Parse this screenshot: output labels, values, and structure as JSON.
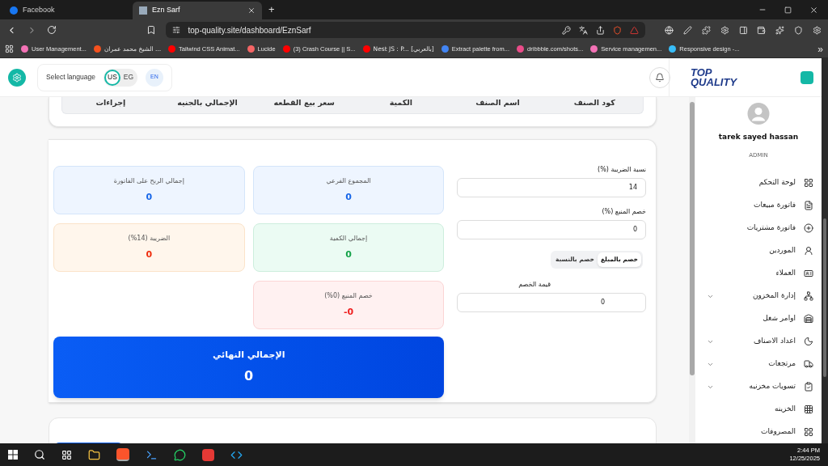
{
  "browser": {
    "tabs": [
      {
        "title": "Ezn Sarf",
        "selected": true
      },
      {
        "title": "Facebook",
        "selected": false
      }
    ],
    "new_tab": "+",
    "url": "top-quality.site/dashboard/EznSarf",
    "bookmarks": [
      {
        "label": "Responsive design -...",
        "color": "#38bdf8"
      },
      {
        "label": "Service managemen...",
        "color": "#f472b6"
      },
      {
        "label": "dribbble.com/shots...",
        "color": "#ea4c89"
      },
      {
        "label": "Extract palette from...",
        "color": "#4285f4"
      },
      {
        "label": "Nest JS : P... [بالعربي]",
        "color": "#ff0000"
      },
      {
        "label": "(3) Crash Course || S...",
        "color": "#ff0000"
      },
      {
        "label": "Lucide",
        "color": "#f56565"
      },
      {
        "label": "Tailwind CSS Animat...",
        "color": "#ff0000"
      },
      {
        "label": "الشيخ محمد عمران ...",
        "color": "#f4511e"
      },
      {
        "label": "User Management...",
        "color": "#f472b6"
      }
    ],
    "more": "»"
  },
  "header": {
    "language_label": "Select language",
    "languages": [
      {
        "label": "EG",
        "selected": false
      },
      {
        "label": "US",
        "selected": true
      }
    ],
    "current": "EN",
    "brand": {
      "line1": "TOP",
      "line2": "QUALITY"
    }
  },
  "items_table": {
    "columns": [
      "كود الصنف",
      "اسم الصنف",
      "الكمية",
      "سعر بيع القطعه",
      "الإجمالي بالجنيه",
      "إجراءات"
    ]
  },
  "summary": {
    "stats": [
      {
        "label": "المجموع الفرعي",
        "value": "0",
        "kind": "blue"
      },
      {
        "label": "إجمالي الربح على الفاتورة",
        "value": "0",
        "kind": "blue"
      },
      {
        "label": "إجمالي الكمية",
        "value": "0",
        "kind": "green"
      },
      {
        "label": "الضريبة (14%)",
        "value": "0",
        "kind": "orange"
      },
      {
        "label": "خصم المنبع (0%)",
        "value": "0-",
        "kind": "red"
      }
    ],
    "form": {
      "tax_label": "نسبة الضريبة (%)",
      "tax_value": "14",
      "withholding_label": "خصم المنبع (%)",
      "withholding_value": "0",
      "discount_modes": [
        {
          "label": "خصم بالمبلغ",
          "selected": true
        },
        {
          "label": "خصم بالنسبة",
          "selected": false
        }
      ],
      "discount_label": "قيمة الخصم",
      "discount_value": "0"
    },
    "final_total": {
      "label": "الإجمالي النهائي",
      "value": "0"
    }
  },
  "sidebar": {
    "user_name": "tarek sayed hassan",
    "role": "ADMIN",
    "items": [
      {
        "label": "لوحة التحكم",
        "has_submenu": false
      },
      {
        "label": "فاتورة مبيعات",
        "has_submenu": false
      },
      {
        "label": "فاتورة مشتريات",
        "has_submenu": false
      },
      {
        "label": "الموردين",
        "has_submenu": false
      },
      {
        "label": "العملاء",
        "has_submenu": false
      },
      {
        "label": "إدارة المخزون",
        "has_submenu": true
      },
      {
        "label": "اوامر شغل",
        "has_submenu": false
      },
      {
        "label": "اعداد الاصناف",
        "has_submenu": true
      },
      {
        "label": "مرتجعات",
        "has_submenu": true
      },
      {
        "label": "تسويات مخزنيه",
        "has_submenu": true
      },
      {
        "label": "الخزينه",
        "has_submenu": false
      },
      {
        "label": "المصروفات",
        "has_submenu": false
      }
    ]
  },
  "taskbar": {
    "time": "2:44 PM",
    "date": "12/25/2025"
  }
}
